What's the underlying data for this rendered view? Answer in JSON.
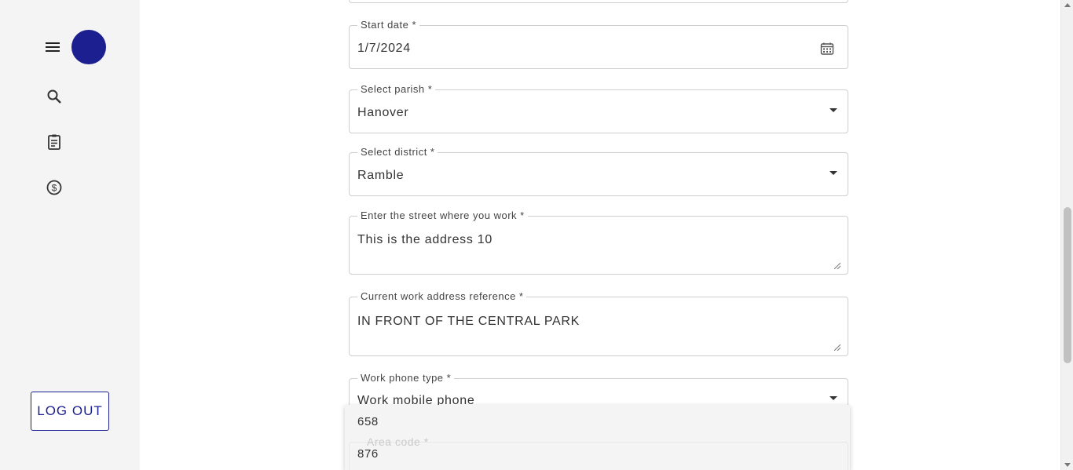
{
  "colors": {
    "brand": "#1c1f8f",
    "sidebar_bg": "#f4f4f4",
    "border": "#cfcfcf"
  },
  "sidebar": {
    "icons": [
      "menu-icon",
      "search-icon",
      "clipboard-icon",
      "dollar-icon"
    ],
    "logout_label": "LOG OUT"
  },
  "form": {
    "start_date": {
      "label": "Start date *",
      "value": "1/7/2024"
    },
    "parish": {
      "label": "Select parish *",
      "value": "Hanover"
    },
    "district": {
      "label": "Select district *",
      "value": "Ramble"
    },
    "street": {
      "label": "Enter the street where you work *",
      "value": "This is the address 10"
    },
    "reference": {
      "label": "Current work address reference *",
      "value": "IN FRONT OF THE CENTRAL PARK"
    },
    "phone_type": {
      "label": "Work phone type *",
      "value": "Work mobile phone"
    },
    "area_code": {
      "label": "Area code *"
    }
  },
  "dropdown": {
    "options": [
      "658",
      "876"
    ]
  }
}
